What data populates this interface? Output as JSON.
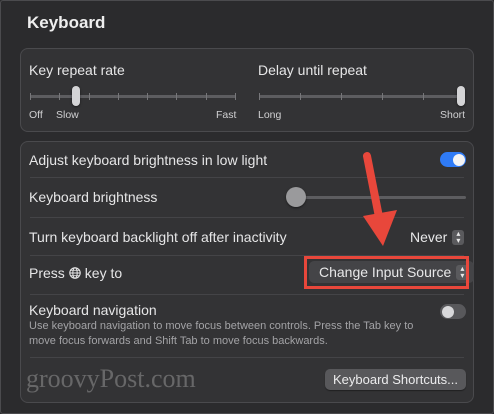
{
  "window": {
    "title": "Keyboard"
  },
  "key_repeat": {
    "label": "Key repeat rate",
    "min_label": "Off",
    "low_label": "Slow",
    "max_label": "Fast",
    "level": 0.15
  },
  "delay_repeat": {
    "label": "Delay until repeat",
    "min_label": "Long",
    "max_label": "Short",
    "level": 1.0
  },
  "settings": {
    "adjust_brightness": {
      "label": "Adjust keyboard brightness in low light",
      "enabled": true
    },
    "brightness": {
      "label": "Keyboard brightness",
      "level": 0.0
    },
    "backlight_off": {
      "label": "Turn keyboard backlight off after inactivity",
      "value": "Never"
    },
    "press_key": {
      "label_before": "Press",
      "label_after": "key to",
      "icon": "globe-icon",
      "value": "Change Input Source"
    },
    "keyboard_navigation": {
      "label": "Keyboard navigation",
      "enabled": false,
      "description": "Use keyboard navigation to move focus between controls. Press the Tab key to move focus forwards and Shift Tab to move focus backwards."
    }
  },
  "buttons": {
    "shortcuts_label": "Keyboard Shortcuts..."
  },
  "watermark": "groovyPost.com",
  "colors": {
    "accent": "#2f7bf6",
    "highlight": "#e8473b"
  }
}
